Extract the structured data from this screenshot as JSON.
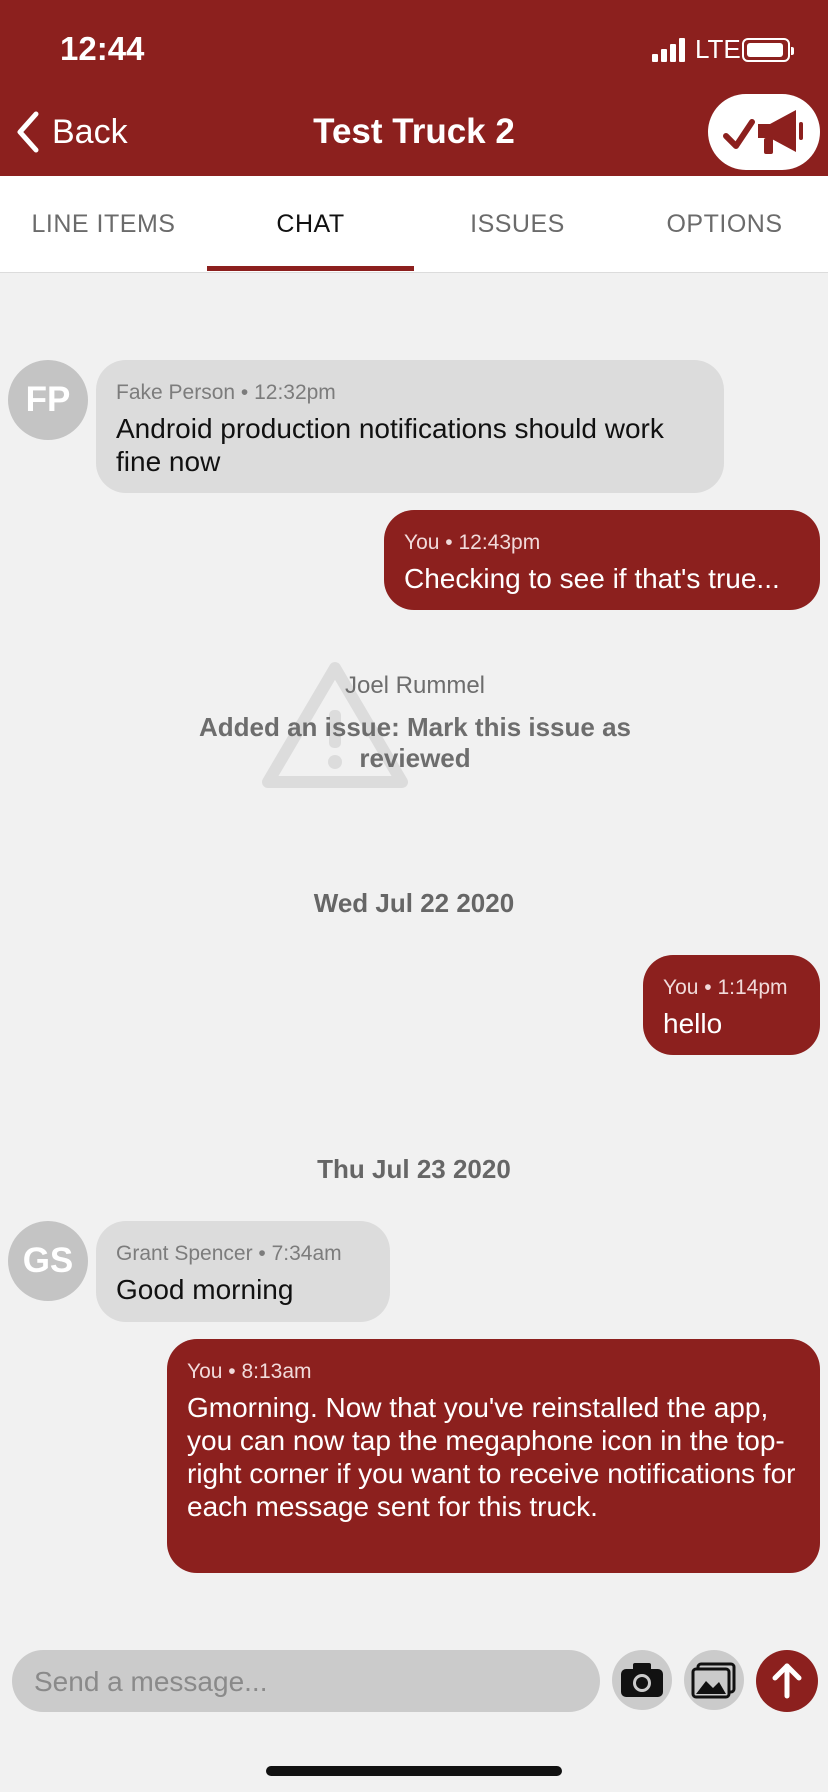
{
  "status": {
    "time": "12:44",
    "network": "LTE"
  },
  "nav": {
    "back_label": "Back",
    "title": "Test Truck 2"
  },
  "tabs": [
    {
      "label": "LINE ITEMS"
    },
    {
      "label": "CHAT"
    },
    {
      "label": "ISSUES"
    },
    {
      "label": "OPTIONS"
    }
  ],
  "active_tab": "CHAT",
  "messages": [
    {
      "initials": "FP",
      "sender": "Fake Person",
      "time": "12:32pm",
      "meta": "Fake Person • 12:32pm",
      "text": "Android production notifications should work fine now"
    },
    {
      "sender": "You",
      "time": "12:43pm",
      "meta": "You • 12:43pm",
      "text": "Checking to see if that's true..."
    },
    {
      "sender": "You",
      "time": "1:14pm",
      "meta": "You • 1:14pm",
      "text": "hello"
    },
    {
      "initials": "GS",
      "sender": "Grant Spencer",
      "time": "7:34am",
      "meta": "Grant Spencer • 7:34am",
      "text": "Good morning"
    },
    {
      "sender": "You",
      "time": "8:13am",
      "meta": "You • 8:13am",
      "text": "Gmorning. Now that you've reinstalled the app, you can now tap the megaphone icon in the top-right corner if you want to receive notifications for each message sent for this truck."
    }
  ],
  "system_event": {
    "author": "Joel Rummel",
    "text": "Added an issue: Mark this issue as reviewed"
  },
  "date_separators": [
    "Wed Jul 22 2020",
    "Thu Jul 23 2020"
  ],
  "composer": {
    "placeholder": "Send a message..."
  },
  "colors": {
    "brand": "#8c201e",
    "background": "#f1f1f1",
    "incoming_bubble": "#dcdcdc"
  },
  "icons": {
    "back": "chevron-left-icon",
    "notify": "megaphone-check-icon",
    "camera": "camera-icon",
    "gallery": "image-gallery-icon",
    "send": "arrow-up-icon",
    "issue": "warning-triangle-icon"
  }
}
